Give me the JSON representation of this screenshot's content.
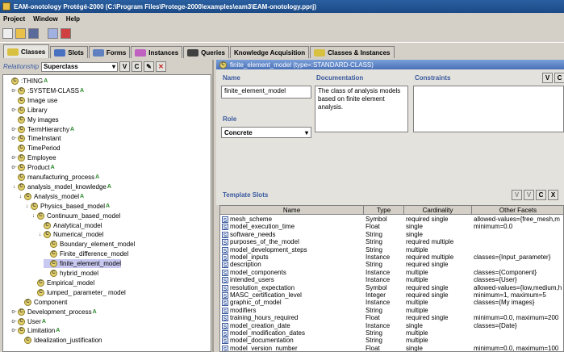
{
  "window": {
    "title": "EAM-onotology  Protégé-2000   (C:\\Program Files\\Protege-2000\\examples\\eam3\\EAM-onotology.pprj)"
  },
  "menu": [
    "Project",
    "Window",
    "Help"
  ],
  "tabs": [
    {
      "label": "Classes",
      "color": "#d8c040"
    },
    {
      "label": "Slots",
      "color": "#4a70c0"
    },
    {
      "label": "Forms",
      "color": "#6080c0"
    },
    {
      "label": "Instances",
      "color": "#c060c0"
    },
    {
      "label": "Queries",
      "color": "#404040"
    },
    {
      "label": "Knowledge Acquisition",
      "color": ""
    },
    {
      "label": "Classes & Instances",
      "color": "#d8c040"
    }
  ],
  "relationship": {
    "label": "Relationship",
    "value": "Superclass",
    "buttons": [
      "V",
      "C"
    ]
  },
  "tree": [
    {
      "label": ":THING",
      "depth": 0,
      "expander": "",
      "marker": "A",
      "selected": false
    },
    {
      "label": ":SYSTEM-CLASS",
      "depth": 1,
      "expander": "o-",
      "marker": "A",
      "selected": false
    },
    {
      "label": "Image use",
      "depth": 1,
      "expander": "",
      "marker": "",
      "selected": false
    },
    {
      "label": "Library",
      "depth": 1,
      "expander": "o-",
      "marker": "",
      "selected": false
    },
    {
      "label": "My images",
      "depth": 1,
      "expander": "",
      "marker": "",
      "selected": false
    },
    {
      "label": "TermHierarchy",
      "depth": 1,
      "expander": "o-",
      "marker": "A",
      "selected": false
    },
    {
      "label": "TimeInstant",
      "depth": 1,
      "expander": "o-",
      "marker": "",
      "selected": false
    },
    {
      "label": "TimePeriod",
      "depth": 1,
      "expander": "",
      "marker": "",
      "selected": false
    },
    {
      "label": "Employee",
      "depth": 1,
      "expander": "o-",
      "marker": "",
      "selected": false
    },
    {
      "label": "Product",
      "depth": 1,
      "expander": "o-",
      "marker": "A",
      "selected": false
    },
    {
      "label": "manufacturing_process",
      "depth": 1,
      "expander": "",
      "marker": "A",
      "selected": false
    },
    {
      "label": "analysis_model_knowledge",
      "depth": 1,
      "expander": "↓",
      "marker": "A",
      "selected": false
    },
    {
      "label": "Analysis_model",
      "depth": 2,
      "expander": "↓",
      "marker": "A",
      "selected": false
    },
    {
      "label": "Physics_based_model",
      "depth": 3,
      "expander": "↓",
      "marker": "A",
      "selected": false
    },
    {
      "label": "Continuum_based_model",
      "depth": 4,
      "expander": "↓",
      "marker": "",
      "selected": false
    },
    {
      "label": "Analytical_model",
      "depth": 5,
      "expander": "",
      "marker": "",
      "selected": false
    },
    {
      "label": "Numerical_model",
      "depth": 5,
      "expander": "↓",
      "marker": "",
      "selected": false
    },
    {
      "label": "Boundary_element_model",
      "depth": 6,
      "expander": "",
      "marker": "",
      "selected": false
    },
    {
      "label": "Finite_difference_model",
      "depth": 6,
      "expander": "",
      "marker": "",
      "selected": false
    },
    {
      "label": "finite_element_model",
      "depth": 6,
      "expander": "",
      "marker": "",
      "selected": true
    },
    {
      "label": "hybrid_model",
      "depth": 6,
      "expander": "",
      "marker": "",
      "selected": false
    },
    {
      "label": "Empirical_model",
      "depth": 4,
      "expander": "",
      "marker": "",
      "selected": false
    },
    {
      "label": "lumped_ parameter_ model",
      "depth": 4,
      "expander": "",
      "marker": "",
      "selected": false
    },
    {
      "label": "Component",
      "depth": 2,
      "expander": "",
      "marker": "",
      "selected": false
    },
    {
      "label": "Development_process",
      "depth": 1,
      "expander": "o-",
      "marker": "A",
      "selected": false
    },
    {
      "label": "User",
      "depth": 1,
      "expander": "o-",
      "marker": "A",
      "selected": false
    },
    {
      "label": "Limitation",
      "depth": 1,
      "expander": "o-",
      "marker": "A",
      "selected": false
    },
    {
      "label": "Idealization_justification",
      "depth": 2,
      "expander": "",
      "marker": "",
      "selected": false
    }
  ],
  "class_header": "finite_element_model    (type=:STANDARD-CLASS)",
  "name": {
    "label": "Name",
    "value": "finite_element_model"
  },
  "documentation": {
    "label": "Documentation",
    "value": "The class of analysis models based on finite element analysis."
  },
  "constraints": {
    "label": "Constraints",
    "buttons": [
      "V",
      "C"
    ]
  },
  "role": {
    "label": "Role",
    "value": "Concrete"
  },
  "template_slots": {
    "label": "Template Slots",
    "buttons": [
      "V",
      "V",
      "C",
      "X"
    ],
    "columns": [
      "Name",
      "Type",
      "Cardinality",
      "Other Facets"
    ],
    "rows": [
      [
        "mesh_scheme",
        "Symbol",
        "required single",
        "allowed-values={free_mesh,m"
      ],
      [
        "model_execution_time",
        "Float",
        "single",
        "minimum=0.0"
      ],
      [
        "software_needs",
        "String",
        "single",
        ""
      ],
      [
        "purposes_of_the_model",
        "String",
        "required multiple",
        ""
      ],
      [
        "model_development_steps",
        "String",
        "multiple",
        ""
      ],
      [
        "model_inputs",
        "Instance",
        "required multiple",
        "classes={Input_parameter}"
      ],
      [
        "description",
        "String",
        "required single",
        ""
      ],
      [
        "model_components",
        "Instance",
        "multiple",
        "classes={Component}"
      ],
      [
        "intended_users",
        "Instance",
        "multiple",
        "classes={User}"
      ],
      [
        "resolution_expectation",
        "Symbol",
        "required single",
        "allowed-values={low,medium,h"
      ],
      [
        "MASC_certification_level",
        "Integer",
        "required single",
        "minimum=1, maximum=5"
      ],
      [
        "graphic_of_model",
        "Instance",
        "multiple",
        "classes={My images}"
      ],
      [
        "modifiers",
        "String",
        "multiple",
        ""
      ],
      [
        "training_hours_required",
        "Float",
        "required single",
        "minimum=0.0, maximum=200"
      ],
      [
        "model_creation_date",
        "Instance",
        "single",
        "classes={Date}"
      ],
      [
        "model_modification_dates",
        "String",
        "multiple",
        ""
      ],
      [
        "model_documentation",
        "String",
        "multiple",
        ""
      ],
      [
        "model_version_number",
        "Float",
        "single",
        "minimum=0.0, maximum=100"
      ]
    ]
  }
}
